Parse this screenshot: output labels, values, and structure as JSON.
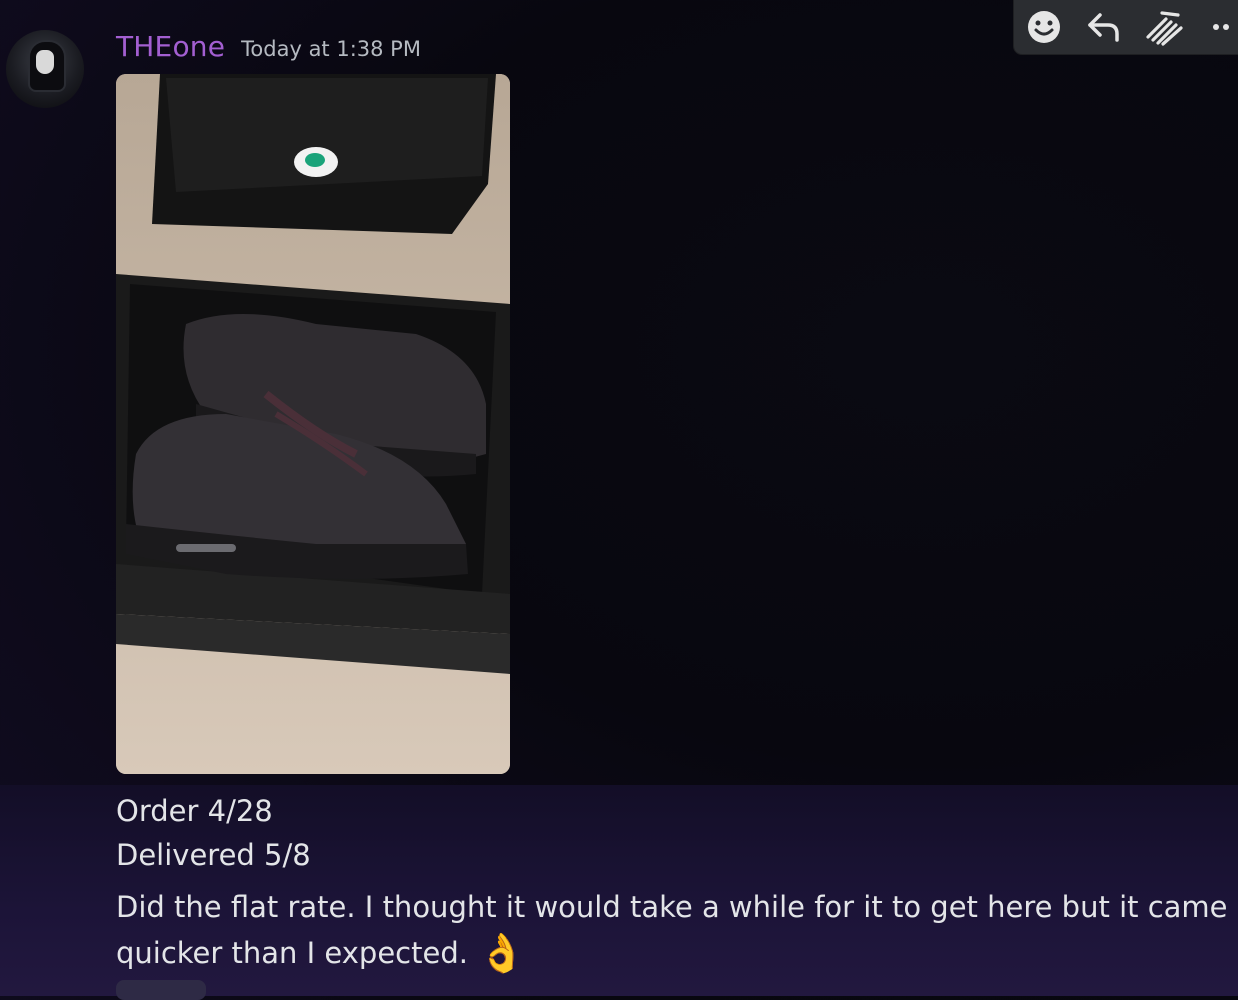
{
  "message": {
    "author": "THEone",
    "timestamp": "Today at 1:38 PM",
    "lines": [
      "Order 4/28",
      "Delivered 5/8",
      "Did the flat rate. I thought it would take a while for it to get here but it came",
      "quicker than I expected."
    ],
    "emoji": "👌",
    "author_color": "#a35fd1"
  },
  "attachment": {
    "icon": "image-attachment"
  },
  "toolbar": {
    "buttons": [
      {
        "icon": "add-reaction-icon"
      },
      {
        "icon": "reply-icon"
      },
      {
        "icon": "thread-icon"
      },
      {
        "icon": "more-options-icon"
      }
    ]
  }
}
